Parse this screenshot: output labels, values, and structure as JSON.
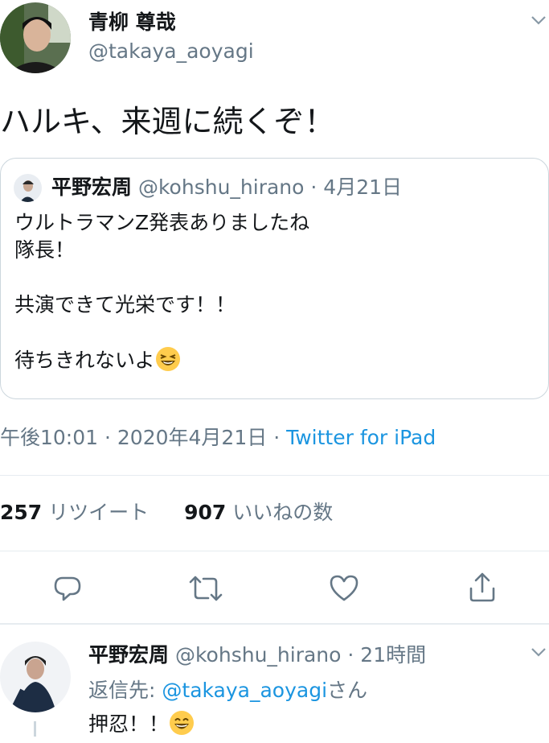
{
  "main_tweet": {
    "display_name": "青柳 尊哉",
    "handle": "@takaya_aoyagi",
    "text": "ハルキ、来週に続くぞ！",
    "timestamp": "午後10:01 · 2020年4月21日",
    "separator": "·",
    "source": "Twitter for iPad",
    "retweets_count": "257",
    "retweets_label": "リツイート",
    "likes_count": "907",
    "likes_label": "いいねの数"
  },
  "quoted_tweet": {
    "display_name": "平野宏周",
    "handle": "@kohshu_hirano",
    "date": "· 4月21日",
    "lines": [
      "ウルトラマンZ発表ありましたね",
      "隊長！",
      "",
      "共演できて光栄です！！",
      "",
      "待ちきれないよ"
    ],
    "emoji": "laughing-face"
  },
  "reply": {
    "display_name": "平野宏周",
    "handle": "@kohshu_hirano",
    "time": "· 21時間",
    "reply_to_label": "返信先:",
    "reply_to_handle": "@takaya_aoyagi",
    "reply_to_suffix": "さん",
    "text": "押忍！！",
    "emoji": "grinning-face"
  },
  "actions": [
    "reply-icon",
    "retweet-icon",
    "like-icon",
    "share-icon"
  ],
  "colors": {
    "link": "#1b95e0",
    "grey": "#657786",
    "border": "#ccd6dd",
    "divider": "#e6ecf0",
    "text": "#14171a"
  }
}
